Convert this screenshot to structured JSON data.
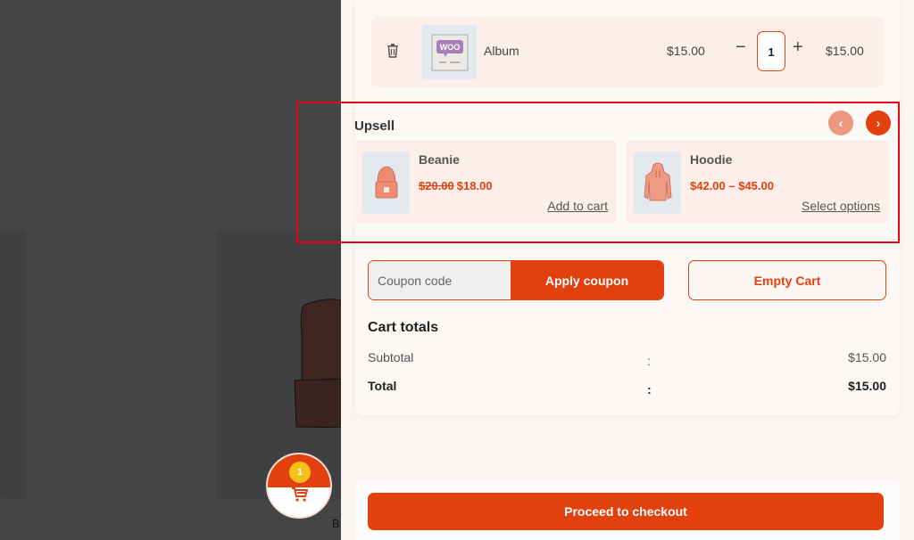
{
  "background": {
    "partial_label": "B"
  },
  "floating_cart": {
    "count": "1",
    "icon": "cart-icon"
  },
  "cart": {
    "items": [
      {
        "name": "Album",
        "price": "$15.00",
        "quantity": "1",
        "subtotal": "$15.00",
        "thumbnail": "woo-album-image",
        "remove_icon": "trash-icon",
        "minus_label": "−",
        "plus_label": "+"
      }
    ]
  },
  "upsell": {
    "title": "Upsell",
    "prev_icon": "chevron-left-icon",
    "next_icon": "chevron-right-icon",
    "prev_label": "‹",
    "next_label": "›",
    "products": [
      {
        "name": "Beanie",
        "regular_price": "$20.00",
        "sale_price": "$18.00",
        "action": "Add to cart",
        "thumbnail": "beanie-image"
      },
      {
        "name": "Hoodie",
        "price_range": "$42.00 – $45.00",
        "action": "Select options",
        "thumbnail": "hoodie-image"
      }
    ]
  },
  "coupon": {
    "placeholder": "Coupon code",
    "value": "",
    "apply_label": "Apply coupon"
  },
  "empty_cart_label": "Empty Cart",
  "totals": {
    "title": "Cart totals",
    "rows": [
      {
        "label": "Subtotal",
        "separator": ":",
        "value": "$15.00"
      },
      {
        "label": "Total",
        "separator": ":",
        "value": "$15.00"
      }
    ]
  },
  "checkout_label": "Proceed to checkout",
  "colors": {
    "accent": "#e2400d",
    "badge": "#f7c11a",
    "highlight": "#e30613"
  }
}
